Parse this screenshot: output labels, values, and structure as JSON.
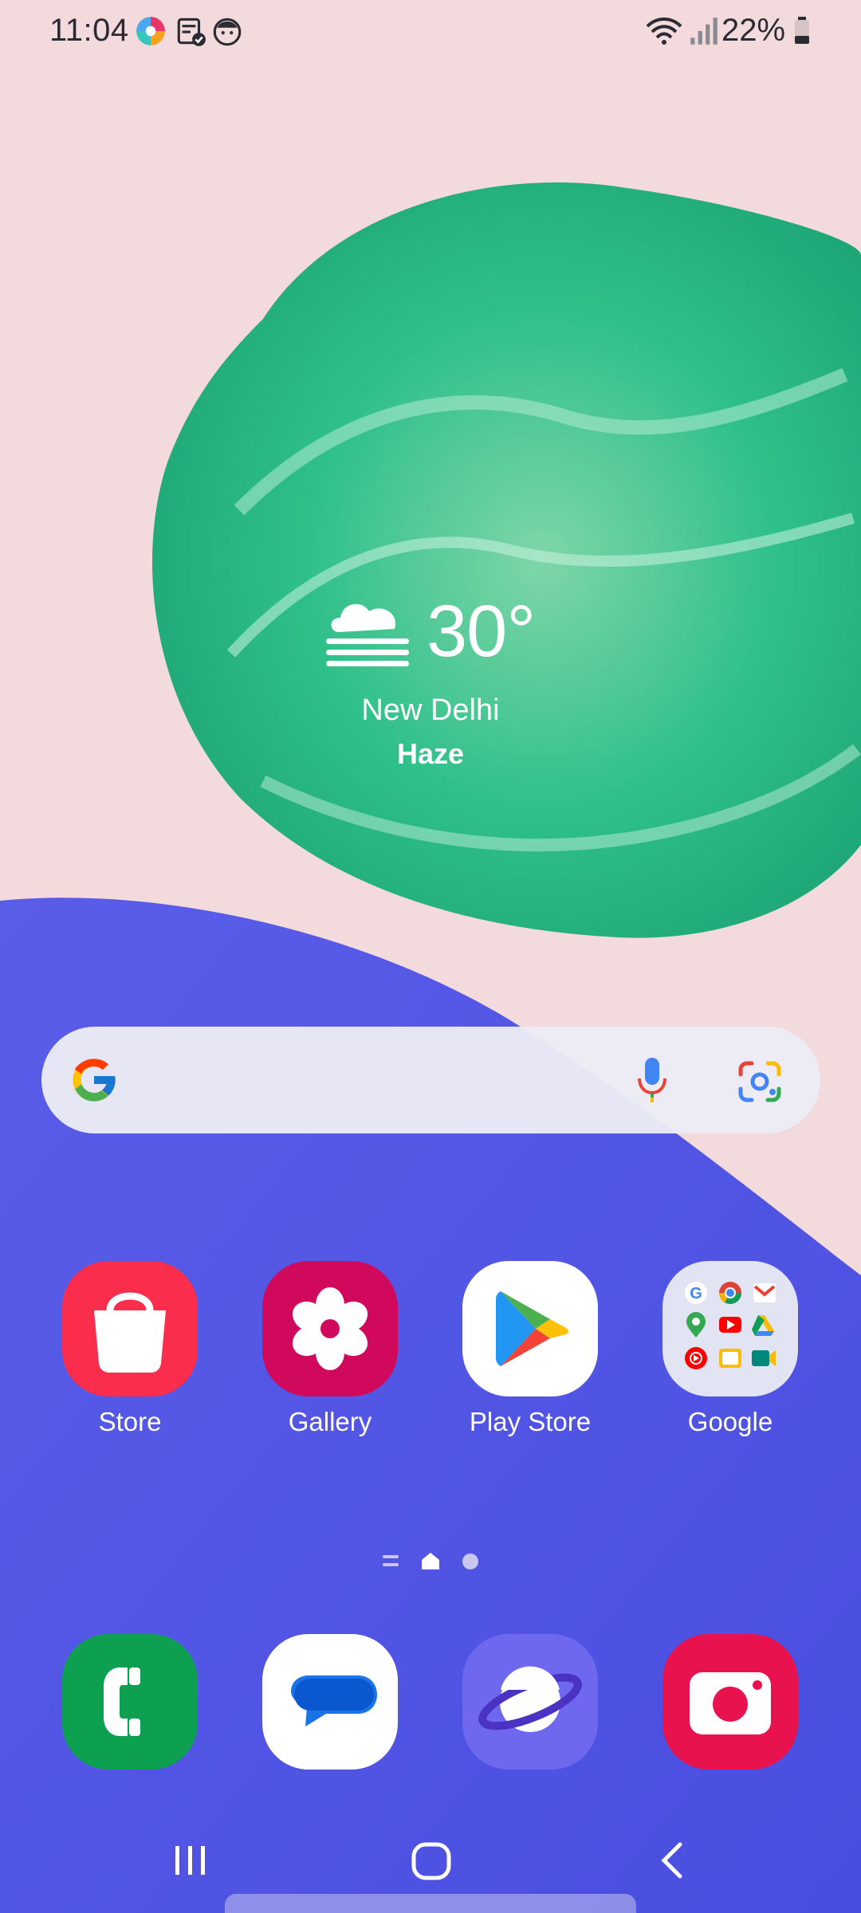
{
  "status_bar": {
    "time": "11:04",
    "battery": "22%",
    "icons": [
      "photos-icon",
      "notes-icon",
      "face-icon",
      "wifi-icon",
      "signal-icon",
      "battery-icon"
    ]
  },
  "weather": {
    "temperature": "30°",
    "city": "New Delhi",
    "condition": "Haze",
    "icon": "haze-cloud-icon"
  },
  "search": {
    "icons": [
      "google-g-icon",
      "microphone-icon",
      "google-lens-icon"
    ]
  },
  "apps": [
    {
      "label": "Store",
      "icon": "shopping-bag-icon",
      "color": "#fb2d4c"
    },
    {
      "label": "Gallery",
      "icon": "flower-icon",
      "color": "#d1095d"
    },
    {
      "label": "Play Store",
      "icon": "play-triangle-icon",
      "color": "#ffffff"
    },
    {
      "label": "Google",
      "icon": "folder-icon",
      "color": "#e3e4f3"
    }
  ],
  "folder_apps": [
    "google-icon",
    "chrome-icon",
    "gmail-icon",
    "maps-icon",
    "youtube-icon",
    "drive-icon",
    "youtube-music-icon",
    "photos-icon",
    "meet-icon"
  ],
  "page_indicator": {
    "pages": 3,
    "current": 1
  },
  "dock": [
    {
      "name": "phone",
      "color": "#0da051"
    },
    {
      "name": "messages",
      "color": "#ffffff"
    },
    {
      "name": "internet",
      "color": "#6d68ee"
    },
    {
      "name": "camera",
      "color": "#e8134e"
    }
  ]
}
